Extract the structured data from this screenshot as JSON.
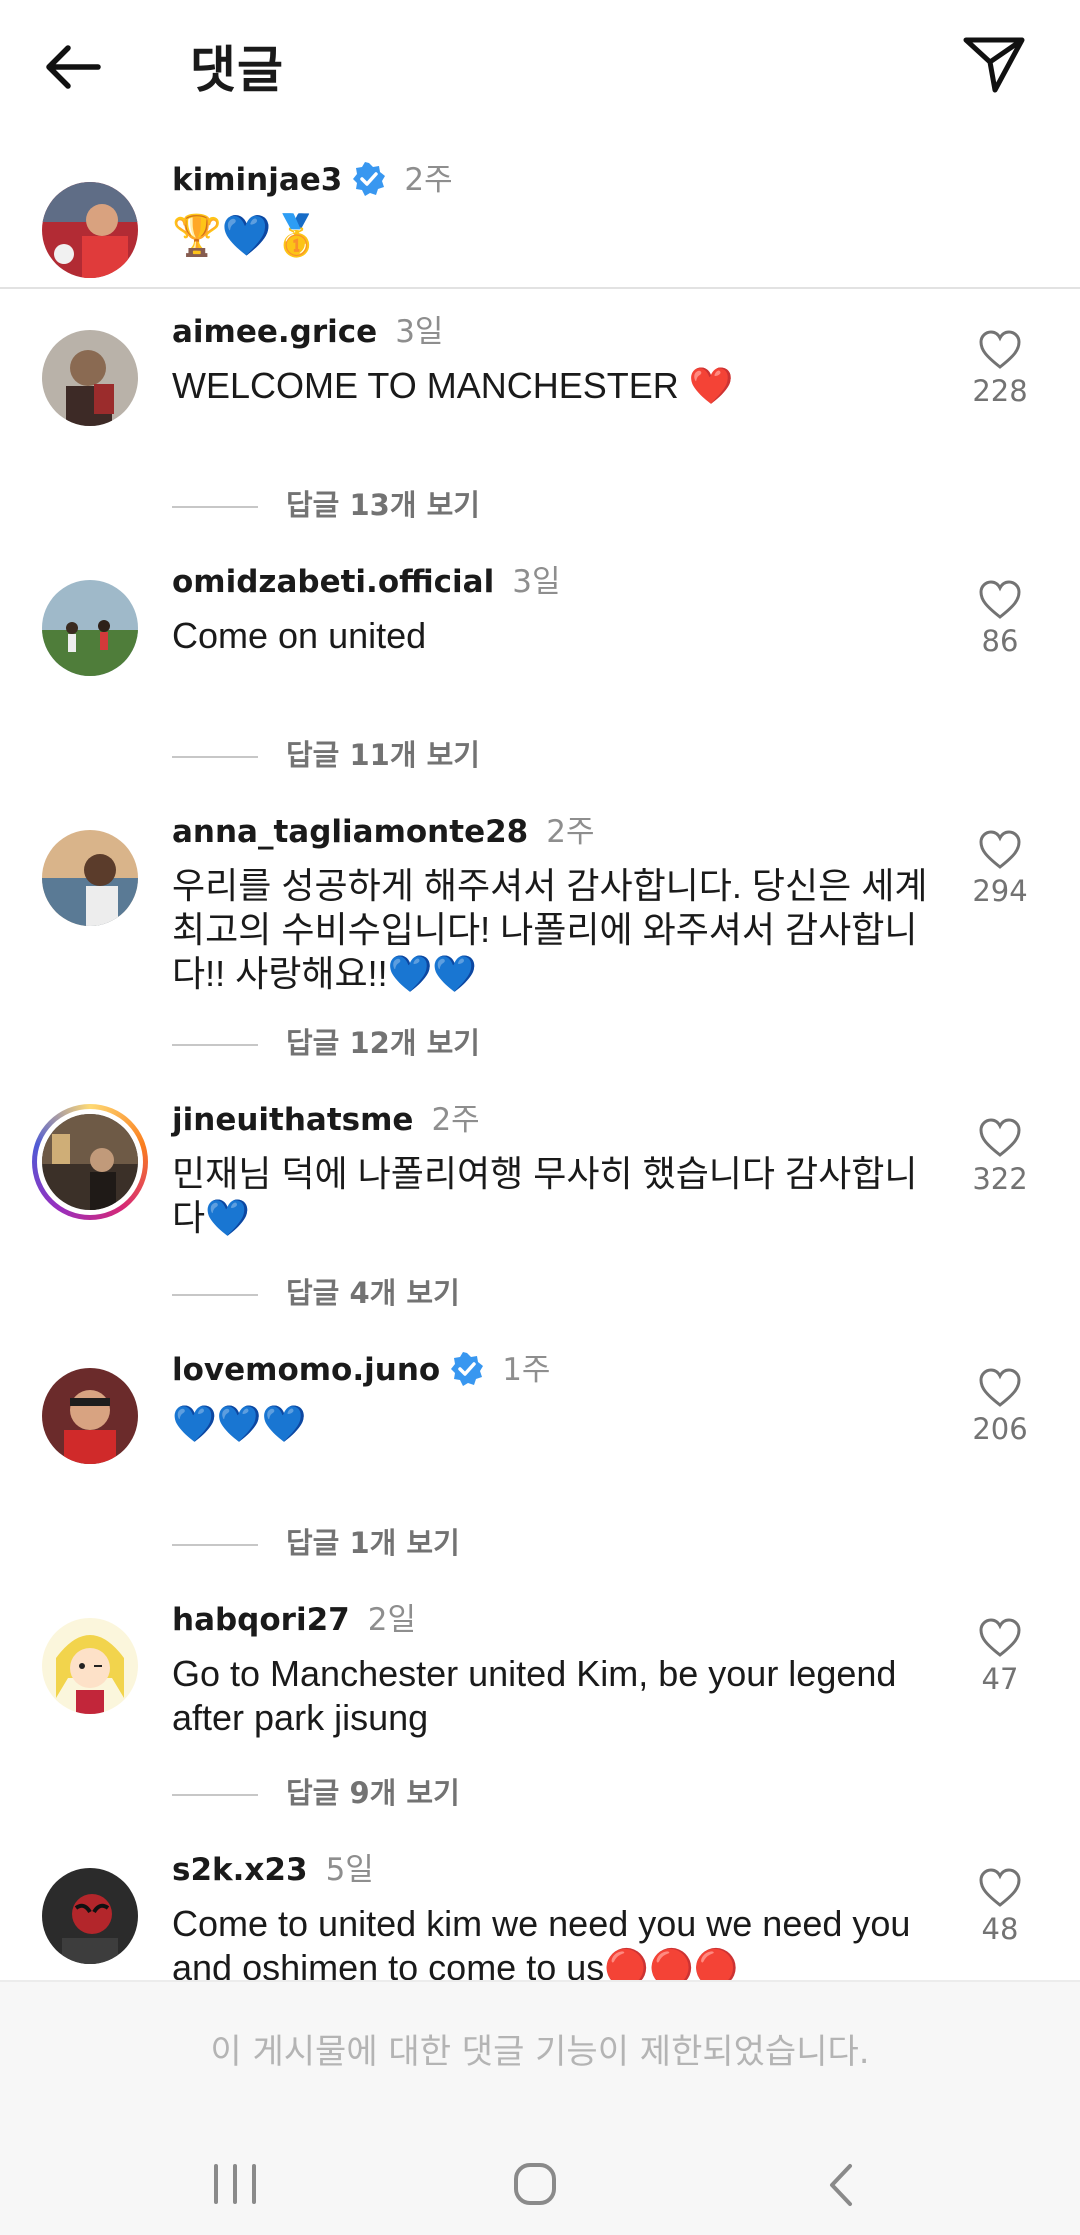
{
  "header": {
    "title": "댓글",
    "back_icon": "arrow-left-icon",
    "share_icon": "paper-plane-icon"
  },
  "caption": {
    "username": "kiminjae3",
    "verified": true,
    "time": "2주",
    "text": "🏆💙🥇"
  },
  "comments": [
    {
      "username": "aimee.grice",
      "time": "3일",
      "text": "WELCOME TO MANCHESTER ❤️",
      "likes": "228",
      "replies": "답글 13개 보기"
    },
    {
      "username": "omidzabeti.official",
      "time": "3일",
      "text": "Come on united",
      "likes": "86",
      "replies": "답글 11개 보기"
    },
    {
      "username": "anna_tagliamonte28",
      "time": "2주",
      "text": "우리를 성공하게 해주셔서 감사합니다. 당신은 세계 최고의 수비수입니다! 나폴리에 와주셔서 감사합니다!! 사랑해요!!💙💙",
      "likes": "294",
      "replies": "답글 12개 보기"
    },
    {
      "username": "jineuithatsme",
      "time": "2주",
      "text": "민재님 덕에 나폴리여행 무사히 했습니다 감사합니다💙",
      "likes": "322",
      "replies": "답글 4개 보기",
      "story_ring": true
    },
    {
      "username": "lovemomo.juno",
      "time": "1주",
      "verified": true,
      "text": "💙💙💙",
      "likes": "206",
      "replies": "답글 1개 보기"
    },
    {
      "username": "habqori27",
      "time": "2일",
      "text": "Go to Manchester united Kim, be your legend after park jisung",
      "likes": "47",
      "replies": "답글 9개 보기"
    },
    {
      "username": "s2k.x23",
      "time": "5일",
      "text": "Come to united kim we need you we need you and oshimen to come to us🔴🔴🔴",
      "likes": "48"
    }
  ],
  "footer": {
    "restricted_text": "이 게시물에 대한 댓글 기능이 제한되었습니다."
  },
  "nav": {
    "recent_icon": "recent-apps-icon",
    "home_icon": "home-icon",
    "back_icon": "back-chevron-icon"
  }
}
